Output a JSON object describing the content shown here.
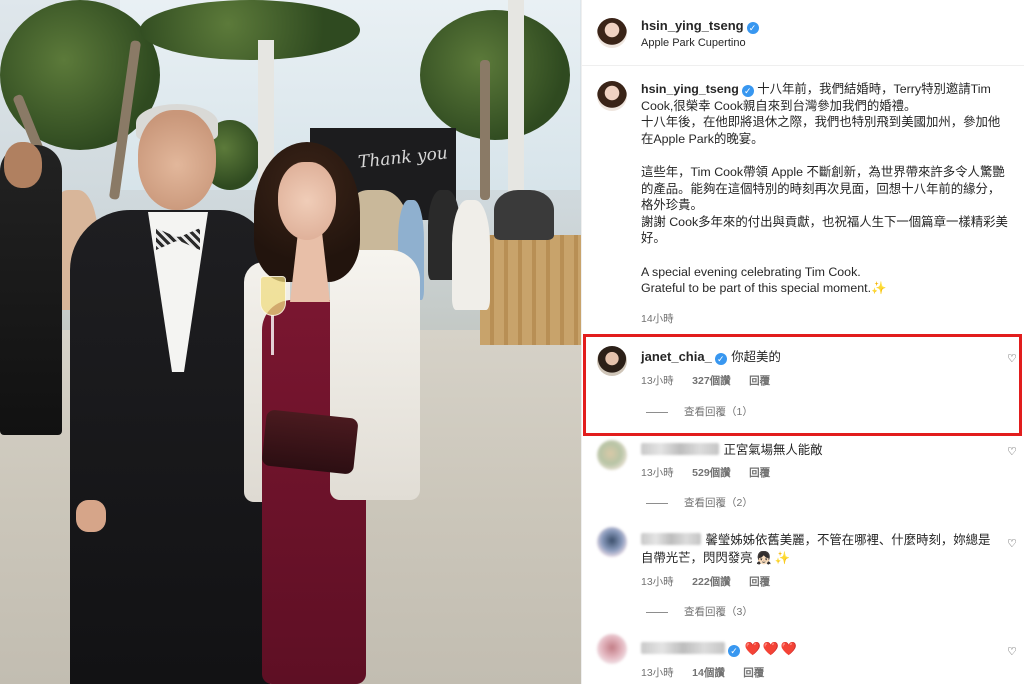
{
  "post": {
    "username": "hsin_ying_tseng",
    "location": "Apple Park Cupertino",
    "photo_screen_text": "Thank you"
  },
  "caption": {
    "username": "hsin_ying_tseng",
    "text": "十八年前，我們結婚時，Terry特別邀請Tim Cook,很榮幸 Cook親自來到台灣參加我們的婚禮。\n十八年後，在他即將退休之際，我們也特別飛到美國加州，參加他在Apple Park的晚宴。\n\n這些年，Tim Cook帶領 Apple 不斷創新，為世界帶來許多令人驚艷的產品。能夠在這個特別的時刻再次見面，回想十八年前的緣分，格外珍貴。\n謝謝 Cook多年來的付出與貢獻，也祝福人生下一個篇章一樣精彩美好。\n\nA special evening celebrating Tim Cook.\nGrateful to be part of this special moment.✨",
    "time": "14小時"
  },
  "comments": [
    {
      "username": "janet_chia_",
      "verified": true,
      "text": "你超美的",
      "time": "13小時",
      "likes": "327個讚",
      "reply": "回覆",
      "view_replies": "查看回覆（1）"
    },
    {
      "username": "",
      "text": "正宮氣場無人能敵",
      "time": "13小時",
      "likes": "529個讚",
      "reply": "回覆",
      "view_replies": "查看回覆（2）"
    },
    {
      "username": "",
      "text_line1": "馨瑩姊姊依舊美麗，不管在哪裡、什麼時刻，妳總是",
      "text_line2": "自帶光芒，閃閃發亮 👧🏻 ✨",
      "time": "13小時",
      "likes": "222個讚",
      "reply": "回覆",
      "view_replies": "查看回覆（3）"
    },
    {
      "username": "",
      "verified": true,
      "text": "❤️❤️❤️",
      "time": "13小時",
      "likes": "14個讚",
      "reply": "回覆"
    }
  ],
  "icons": {
    "verified": "verified-badge-icon",
    "like": "heart-outline-icon"
  },
  "colors": {
    "highlight_border": "#e21d1d",
    "verified_blue": "#3897f0",
    "meta_gray": "#737373"
  }
}
